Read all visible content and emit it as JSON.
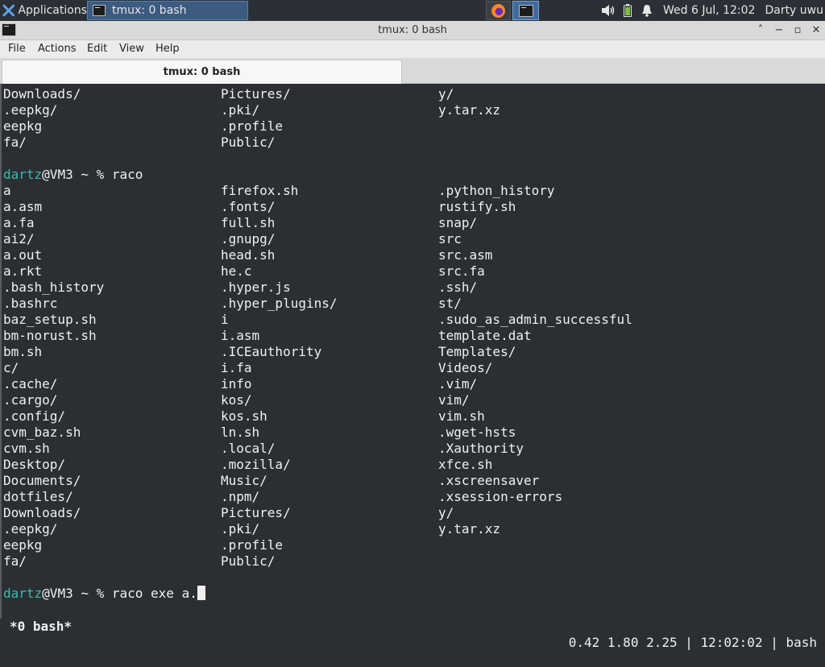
{
  "panel": {
    "applications_label": "Applications",
    "task_title": "tmux: 0 bash",
    "clock": "Wed  6 Jul, 12:02",
    "user": "Darty uwu"
  },
  "window": {
    "title": "tmux: 0 bash",
    "min_glyph": "˄",
    "max_glyph": "−",
    "restore_glyph": "▫",
    "close_glyph": "✕"
  },
  "menu": [
    "File",
    "Actions",
    "Edit",
    "View",
    "Help"
  ],
  "tab": {
    "label": "tmux: 0 bash"
  },
  "terminal": {
    "top_rows": [
      [
        "Downloads/",
        "Pictures/",
        "y/"
      ],
      [
        ".eepkg/",
        ".pki/",
        "y.tar.xz"
      ],
      [
        "eepkg",
        ".profile",
        ""
      ],
      [
        "fa/",
        "Public/",
        ""
      ]
    ],
    "prompt1": {
      "user": "dartz",
      "rest": "@VM3 ~ % raco"
    },
    "rows": [
      [
        "a",
        "firefox.sh",
        ".python_history"
      ],
      [
        "a.asm",
        ".fonts/",
        "rustify.sh"
      ],
      [
        "a.fa",
        "full.sh",
        "snap/"
      ],
      [
        "ai2/",
        ".gnupg/",
        "src"
      ],
      [
        "a.out",
        "head.sh",
        "src.asm"
      ],
      [
        "a.rkt",
        "he.c",
        "src.fa"
      ],
      [
        ".bash_history",
        ".hyper.js",
        ".ssh/"
      ],
      [
        ".bashrc",
        ".hyper_plugins/",
        "st/"
      ],
      [
        "baz_setup.sh",
        "i",
        ".sudo_as_admin_successful"
      ],
      [
        "bm-norust.sh",
        "i.asm",
        "template.dat"
      ],
      [
        "bm.sh",
        ".ICEauthority",
        "Templates/"
      ],
      [
        "c/",
        "i.fa",
        "Videos/"
      ],
      [
        ".cache/",
        "info",
        ".vim/"
      ],
      [
        ".cargo/",
        "kos/",
        "vim/"
      ],
      [
        ".config/",
        "kos.sh",
        "vim.sh"
      ],
      [
        "cvm_baz.sh",
        "ln.sh",
        ".wget-hsts"
      ],
      [
        "cvm.sh",
        ".local/",
        ".Xauthority"
      ],
      [
        "Desktop/",
        ".mozilla/",
        "xfce.sh"
      ],
      [
        "Documents/",
        "Music/",
        ".xscreensaver"
      ],
      [
        "dotfiles/",
        ".npm/",
        ".xsession-errors"
      ],
      [
        "Downloads/",
        "Pictures/",
        "y/"
      ],
      [
        ".eepkg/",
        ".pki/",
        "y.tar.xz"
      ],
      [
        "eepkg",
        ".profile",
        ""
      ],
      [
        "fa/",
        "Public/",
        ""
      ]
    ],
    "prompt2": {
      "user": "dartz",
      "rest": "@VM3 ~ % raco exe a."
    },
    "status_left": "*0 bash*",
    "status_right": "0.42 1.80 2.25 | 12:02:02 | bash"
  }
}
